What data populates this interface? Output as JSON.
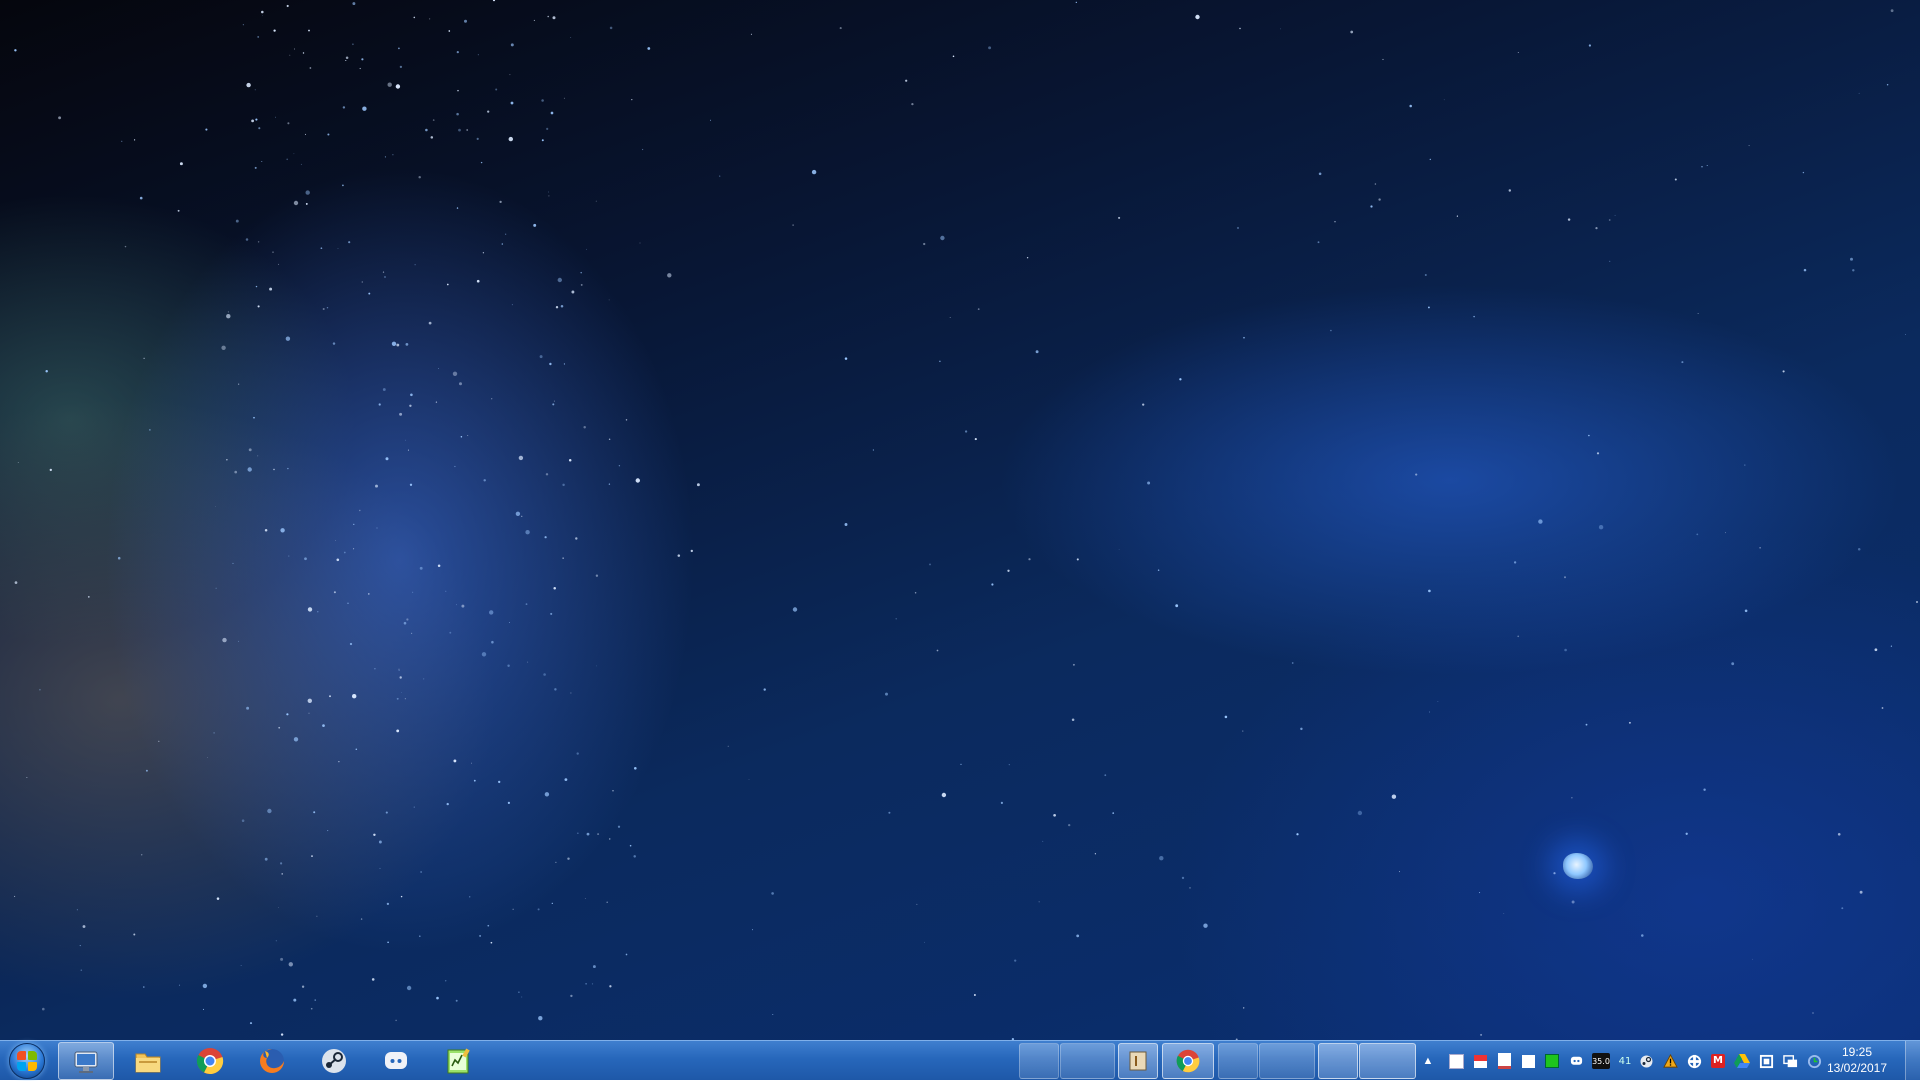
{
  "desktop": {
    "wallpaper": "space-nebula",
    "colors": {
      "deep": "#05060d",
      "mid": "#0b2a5e",
      "glow": "#2f6fe0"
    }
  },
  "taskbar": {
    "start": {
      "icon": "windows-orb-icon"
    },
    "pinned": [
      {
        "name": "network-explorer",
        "icon": "network-monitor-icon",
        "active": true
      },
      {
        "name": "file-explorer",
        "icon": "folder-icon"
      },
      {
        "name": "chrome",
        "icon": "chrome-icon"
      },
      {
        "name": "firefox",
        "icon": "firefox-icon"
      },
      {
        "name": "steam",
        "icon": "steam-icon"
      },
      {
        "name": "discord",
        "icon": "discord-icon"
      },
      {
        "name": "notepad-plus",
        "icon": "notepad-chart-icon"
      }
    ],
    "open_windows": [
      {
        "name": "window-1"
      },
      {
        "name": "window-2"
      },
      {
        "name": "window-3",
        "icon": "document-icon"
      },
      {
        "name": "window-4",
        "icon": "chrome-icon"
      },
      {
        "name": "window-5"
      },
      {
        "name": "window-6"
      },
      {
        "name": "window-7"
      },
      {
        "name": "window-8"
      }
    ],
    "tray": {
      "icons": [
        "white-square-icon",
        "red-white-flag-icon",
        "white-square-icon",
        "white-square-icon",
        "green-square-icon",
        "discord-icon",
        "cpu-temp-icon",
        "gpu-temp-icon",
        "steam-icon",
        "warning-icon",
        "network-share-icon",
        "red-m-icon",
        "google-drive-icon",
        "settings-icon",
        "display-icon",
        "clock-icon"
      ],
      "badges": {
        "cpu": "35.0",
        "gpu": "41"
      }
    },
    "clock": {
      "time": "19:25",
      "date": "13/02/2017"
    }
  }
}
